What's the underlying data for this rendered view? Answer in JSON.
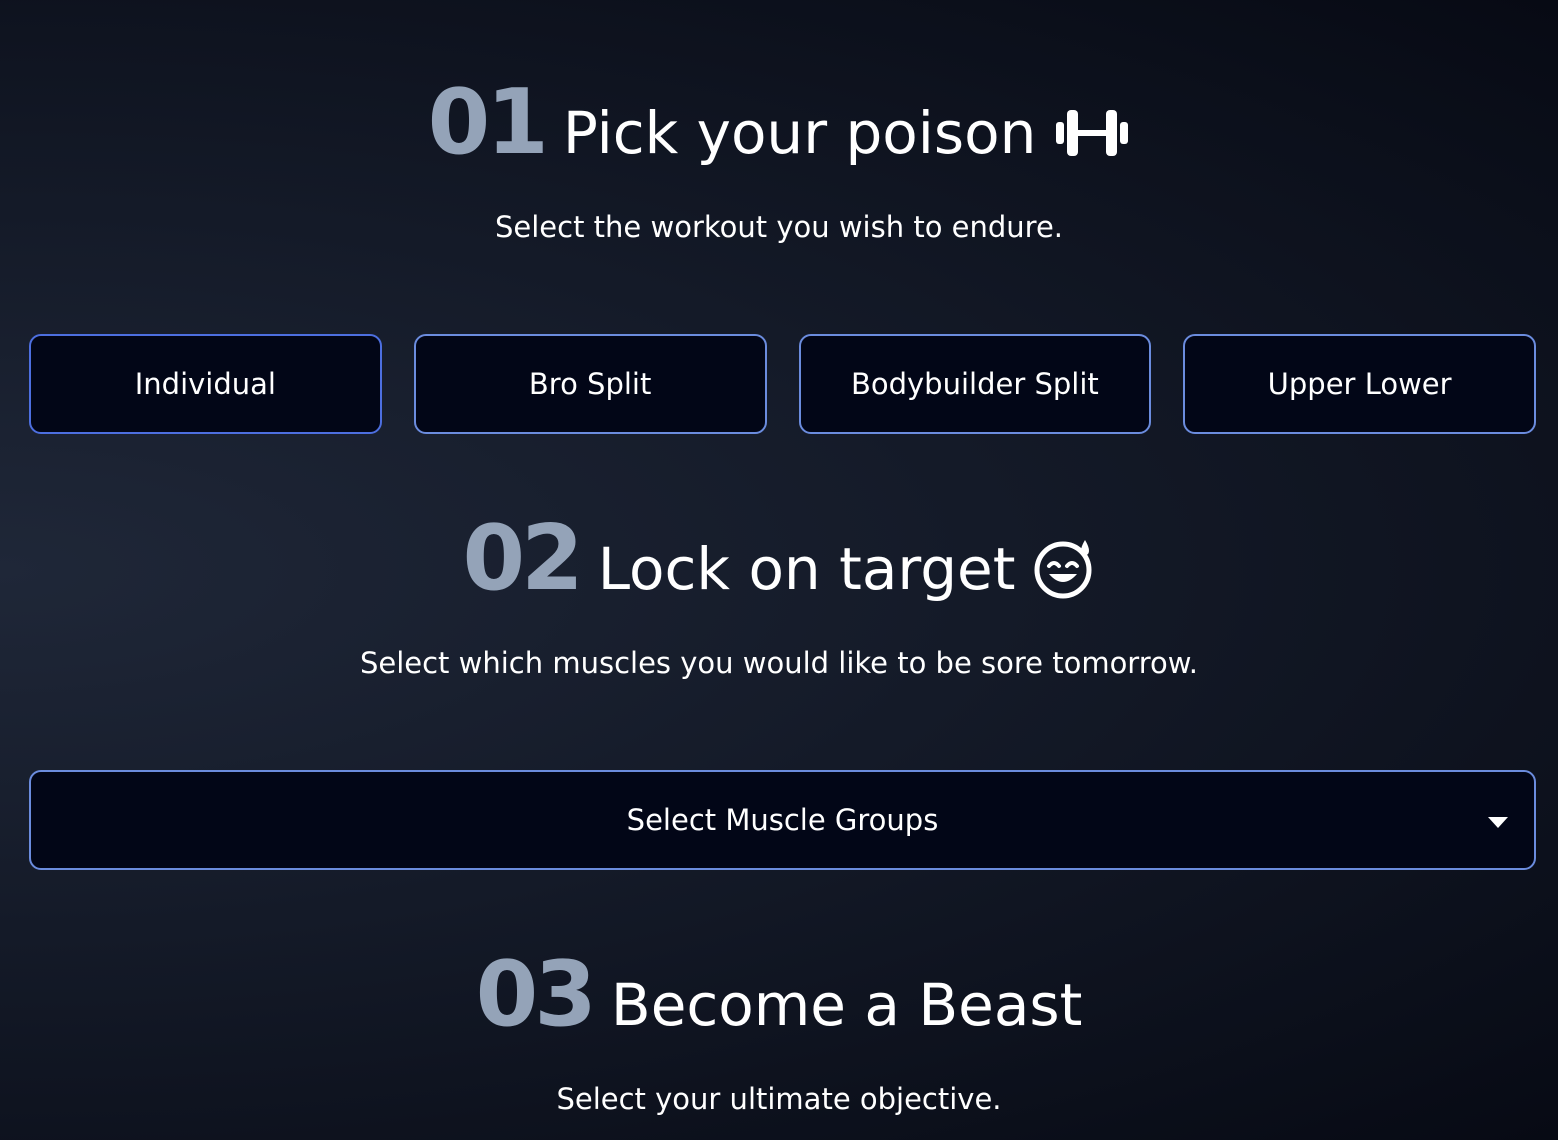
{
  "step1": {
    "number": "01",
    "title": "Pick your poison",
    "icon": "dumbbell-icon",
    "subtitle": "Select the workout you wish to endure.",
    "options": [
      "Individual",
      "Bro Split",
      "Bodybuilder Split",
      "Upper Lower"
    ]
  },
  "step2": {
    "number": "02",
    "title": "Lock on target",
    "icon": "smiling-face-with-sweat-icon",
    "subtitle": "Select which muscles you would like to be sore tomorrow.",
    "select": {
      "placeholder": "Select Muscle Groups",
      "icon": "caret-down-icon"
    }
  },
  "step3": {
    "number": "03",
    "title": "Become a Beast",
    "subtitle": "Select your ultimate objective."
  },
  "colors": {
    "accent_border": "#6b8cde",
    "step_number": "#94a3b8",
    "button_bg": "#020617"
  }
}
